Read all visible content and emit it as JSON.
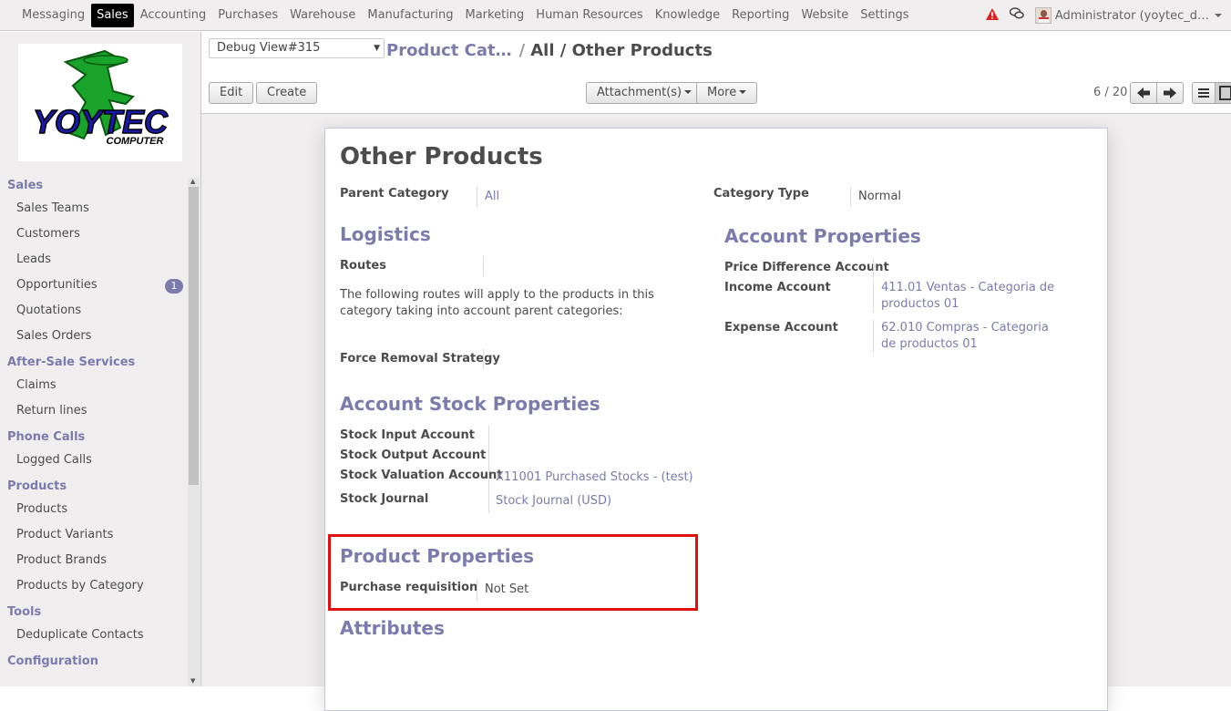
{
  "topnav": {
    "items": [
      "Messaging",
      "Sales",
      "Accounting",
      "Purchases",
      "Warehouse",
      "Manufacturing",
      "Marketing",
      "Human Resources",
      "Knowledge",
      "Reporting",
      "Website",
      "Settings"
    ],
    "active": "Sales",
    "user": "Administrator (yoytec_d…",
    "colors": {
      "alert": "#e02020",
      "active_bg": "#000000"
    }
  },
  "sidebar": {
    "logo_text": "YOYTEC",
    "logo_sub": "COMPUTER",
    "sections": [
      {
        "title": "Sales",
        "items": [
          {
            "label": "Sales Teams"
          },
          {
            "label": "Customers"
          },
          {
            "label": "Leads"
          },
          {
            "label": "Opportunities",
            "badge": "1"
          },
          {
            "label": "Quotations"
          },
          {
            "label": "Sales Orders"
          }
        ]
      },
      {
        "title": "After-Sale Services",
        "items": [
          {
            "label": "Claims"
          },
          {
            "label": "Return lines"
          }
        ]
      },
      {
        "title": "Phone Calls",
        "items": [
          {
            "label": "Logged Calls"
          }
        ]
      },
      {
        "title": "Products",
        "items": [
          {
            "label": "Products"
          },
          {
            "label": "Product Variants"
          },
          {
            "label": "Product Brands"
          },
          {
            "label": "Products by Category"
          }
        ]
      },
      {
        "title": "Tools",
        "items": [
          {
            "label": "Deduplicate Contacts"
          }
        ]
      },
      {
        "title": "Configuration",
        "items": []
      }
    ]
  },
  "control_panel": {
    "debug_view": "Debug View#315",
    "breadcrumb_link": "Product Cat…",
    "breadcrumb_current": "All / Other Products",
    "edit_label": "Edit",
    "create_label": "Create",
    "attachments_label": "Attachment(s)",
    "more_label": "More",
    "pager": "6 / 20"
  },
  "form": {
    "title": "Other Products",
    "parent_category_label": "Parent Category",
    "parent_category_value": "All",
    "category_type_label": "Category Type",
    "category_type_value": "Normal",
    "logistics": {
      "title": "Logistics",
      "routes_label": "Routes",
      "routes_note": "The following routes will apply to the products in this category taking into account parent categories:",
      "force_removal_label": "Force Removal Strategy"
    },
    "account_properties": {
      "title": "Account Properties",
      "price_diff_label": "Price Difference Account",
      "income_label": "Income Account",
      "income_value": "411.01 Ventas - Categoria de productos 01",
      "expense_label": "Expense Account",
      "expense_value": "62.010 Compras - Categoria de productos 01"
    },
    "stock_properties": {
      "title": "Account Stock Properties",
      "input_label": "Stock Input Account",
      "output_label": "Stock Output Account",
      "valuation_label": "Stock Valuation Account",
      "valuation_value": "X11001 Purchased Stocks - (test)",
      "journal_label": "Stock Journal",
      "journal_value": "Stock Journal (USD)"
    },
    "product_properties": {
      "title": "Product Properties",
      "purchase_req_label": "Purchase requisition",
      "purchase_req_value": "Not Set"
    },
    "attributes_title": "Attributes"
  }
}
